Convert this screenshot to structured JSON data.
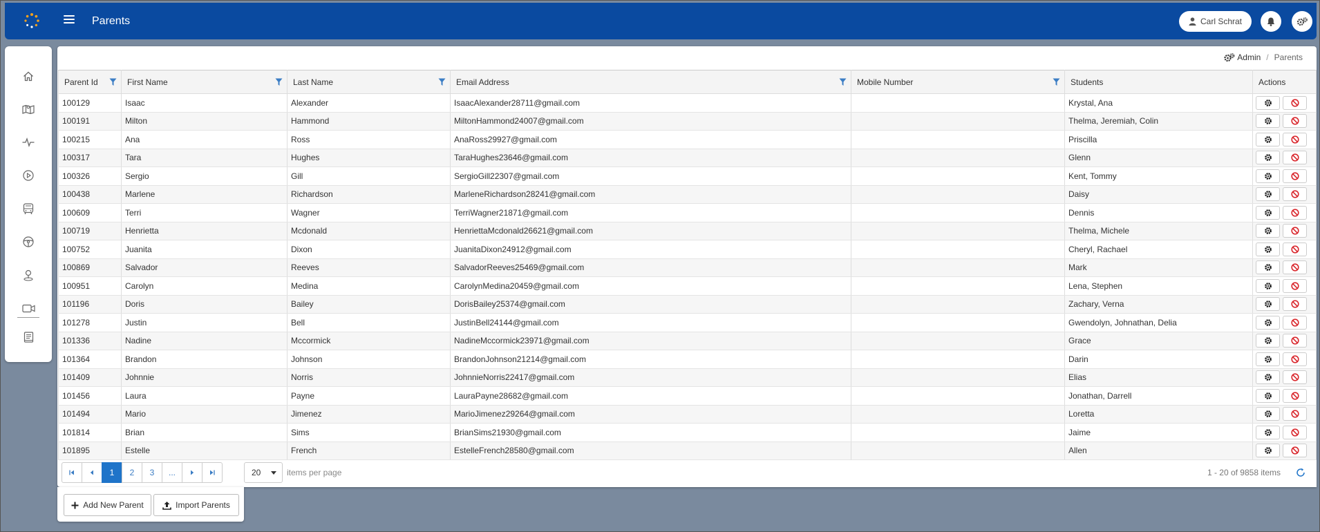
{
  "header": {
    "title": "Parents",
    "user_name": "Carl Schrat"
  },
  "breadcrumb": {
    "admin": "Admin",
    "current": "Parents"
  },
  "sidebar": {
    "items": [
      "home-icon",
      "map-icon",
      "activity-icon",
      "play-icon",
      "bus-icon",
      "steering-wheel-icon",
      "map-pin-icon",
      "video-icon",
      "book-icon"
    ]
  },
  "table": {
    "columns": [
      "Parent Id",
      "First Name",
      "Last Name",
      "Email Address",
      "Mobile Number",
      "Students",
      "Actions"
    ],
    "rows": [
      [
        "100129",
        "Isaac",
        "Alexander",
        "IsaacAlexander28711@gmail.com",
        "",
        "Krystal, Ana"
      ],
      [
        "100191",
        "Milton",
        "Hammond",
        "MiltonHammond24007@gmail.com",
        "",
        "Thelma, Jeremiah, Colin"
      ],
      [
        "100215",
        "Ana",
        "Ross",
        "AnaRoss29927@gmail.com",
        "",
        "Priscilla"
      ],
      [
        "100317",
        "Tara",
        "Hughes",
        "TaraHughes23646@gmail.com",
        "",
        "Glenn"
      ],
      [
        "100326",
        "Sergio",
        "Gill",
        "SergioGill22307@gmail.com",
        "",
        "Kent, Tommy"
      ],
      [
        "100438",
        "Marlene",
        "Richardson",
        "MarleneRichardson28241@gmail.com",
        "",
        "Daisy"
      ],
      [
        "100609",
        "Terri",
        "Wagner",
        "TerriWagner21871@gmail.com",
        "",
        "Dennis"
      ],
      [
        "100719",
        "Henrietta",
        "Mcdonald",
        "HenriettaMcdonald26621@gmail.com",
        "",
        "Thelma, Michele"
      ],
      [
        "100752",
        "Juanita",
        "Dixon",
        "JuanitaDixon24912@gmail.com",
        "",
        "Cheryl, Rachael"
      ],
      [
        "100869",
        "Salvador",
        "Reeves",
        "SalvadorReeves25469@gmail.com",
        "",
        "Mark"
      ],
      [
        "100951",
        "Carolyn",
        "Medina",
        "CarolynMedina20459@gmail.com",
        "",
        "Lena, Stephen"
      ],
      [
        "101196",
        "Doris",
        "Bailey",
        "DorisBailey25374@gmail.com",
        "",
        "Zachary, Verna"
      ],
      [
        "101278",
        "Justin",
        "Bell",
        "JustinBell24144@gmail.com",
        "",
        "Gwendolyn, Johnathan, Delia"
      ],
      [
        "101336",
        "Nadine",
        "Mccormick",
        "NadineMccormick23971@gmail.com",
        "",
        "Grace"
      ],
      [
        "101364",
        "Brandon",
        "Johnson",
        "BrandonJohnson21214@gmail.com",
        "",
        "Darin"
      ],
      [
        "101409",
        "Johnnie",
        "Norris",
        "JohnnieNorris22417@gmail.com",
        "",
        "Elias"
      ],
      [
        "101456",
        "Laura",
        "Payne",
        "LauraPayne28682@gmail.com",
        "",
        "Jonathan, Darrell"
      ],
      [
        "101494",
        "Mario",
        "Jimenez",
        "MarioJimenez29264@gmail.com",
        "",
        "Loretta"
      ],
      [
        "101814",
        "Brian",
        "Sims",
        "BrianSims21930@gmail.com",
        "",
        "Jaime"
      ],
      [
        "101895",
        "Estelle",
        "French",
        "EstelleFrench28580@gmail.com",
        "",
        "Allen"
      ]
    ]
  },
  "pager": {
    "pages": [
      "1",
      "2",
      "3",
      "..."
    ],
    "current": "1",
    "per_page": "20",
    "per_page_label": "items per page",
    "items_count": "1 - 20 of 9858 items"
  },
  "footer": {
    "add_label": "Add New Parent",
    "import_label": "Import Parents"
  },
  "colors": {
    "header_bg": "#0a4aa0",
    "accent": "#1f74c9",
    "danger": "#d9262c",
    "filter": "#3b7dc4"
  }
}
